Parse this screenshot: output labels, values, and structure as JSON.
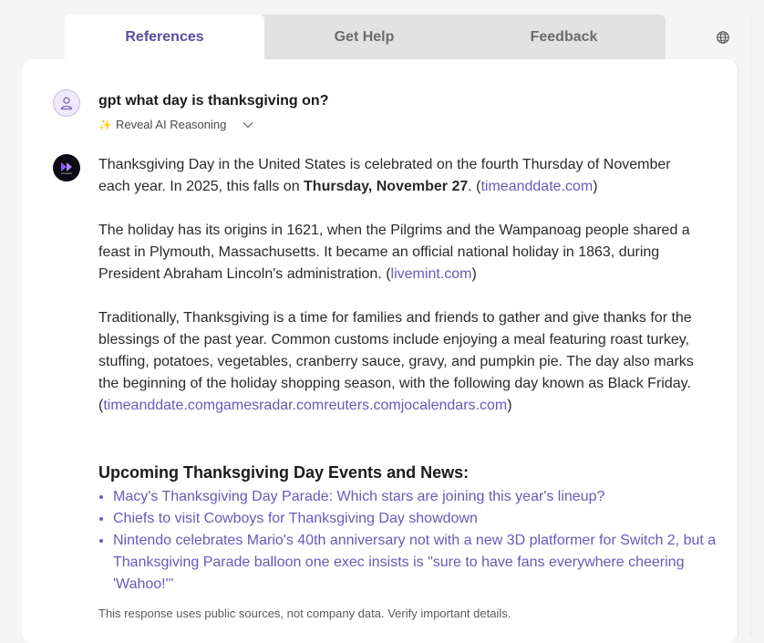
{
  "tabs": [
    {
      "label": "References",
      "active": true
    },
    {
      "label": "Get Help",
      "active": false
    },
    {
      "label": "Feedback",
      "active": false
    }
  ],
  "icons": {
    "globe": "globe-icon",
    "user": "user-icon",
    "bot": "assistant-logo-icon",
    "chevron": "chevron-down-icon",
    "sparkle": "sparkle-icon"
  },
  "colors": {
    "accent": "#6b58b8",
    "active_tab": "#5b4d9b",
    "tab_bar": "#e2e2e2"
  },
  "conversation": {
    "question": "gpt what day is thanksgiving on?",
    "reveal_label": "Reveal AI Reasoning",
    "sparkle": "✨",
    "answer": {
      "p1_a": "Thanksgiving Day in the United States is celebrated on the fourth Thursday of November each year. In 2025, this falls on ",
      "p1_bold": "Thursday, November 27",
      "p1_b": ". (",
      "p1_link": "timeanddate.com",
      "p1_c": ")",
      "p2_a": "The holiday has its origins in 1621, when the Pilgrims and the Wampanoag people shared a feast in Plymouth, Massachusetts. It became an official national holiday in 1863, during President Abraham Lincoln's administration. (",
      "p2_link": "livemint.com",
      "p2_b": ")",
      "p3_a": "Traditionally, Thanksgiving is a time for families and friends to gather and give thanks for the blessings of the past year. Common customs include enjoying a meal featuring roast turkey, stuffing, potatoes, vegetables, cranberry sauce, gravy, and pumpkin pie. The day also marks the beginning of the holiday shopping season, with the following day known as Black Friday. (",
      "p3_links": [
        "timeanddate.com",
        "gamesradar.com",
        "reuters.com",
        "jocalendars.com"
      ],
      "p3_b": ")"
    },
    "events_title": "Upcoming Thanksgiving Day Events and News:",
    "events": [
      "Macy's Thanksgiving Day Parade: Which stars are joining this year's lineup?",
      "Chiefs to visit Cowboys for Thanksgiving Day showdown",
      "Nintendo celebrates Mario's 40th anniversary not with a new 3D platformer for Switch 2, but a Thanksgiving Parade balloon one exec insists is \"sure to have fans everywhere cheering 'Wahoo!'\""
    ],
    "disclaimer": "This response uses public sources, not company data. Verify important details."
  }
}
